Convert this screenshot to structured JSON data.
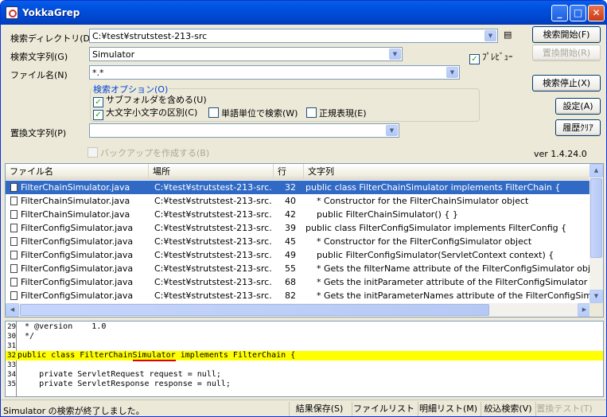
{
  "window": {
    "title": "YokkaGrep"
  },
  "form": {
    "search_dir_label": "検索ディレクトリ(D)",
    "search_dir_value": "C:¥test¥strutstest-213-src",
    "search_str_label": "検索文字列(G)",
    "search_str_value": "Simulator",
    "file_name_label": "ファイル名(N)",
    "file_name_value": "*.*",
    "replace_label": "置換文字列(P)",
    "replace_value": "",
    "preview_label": "ﾌﾟﾚﾋﾞｭｰ",
    "options_title": "検索オプション(O)",
    "opt_subfolder": "サブフォルダを含める(U)",
    "opt_case": "大文字小文字の区別(C)",
    "opt_word": "単語単位で検索(W)",
    "opt_regex": "正規表現(E)",
    "backup": "バックアップを作成する(B)",
    "version": "ver 1.4.24.0"
  },
  "buttons": {
    "start": "検索開始(F)",
    "replace_start": "置換開始(R)",
    "stop": "検索停止(X)",
    "settings": "設定(A)",
    "clear_history": "履歴ｸﾘｱ"
  },
  "list": {
    "headers": [
      "ファイル名",
      "場所",
      "行",
      "文字列"
    ],
    "rows": [
      {
        "file": "FilterChainSimulator.java",
        "path": "C:¥test¥strutstest-213-src...",
        "line": "32",
        "text": "public class FilterChainSimulator implements FilterChain {"
      },
      {
        "file": "FilterChainSimulator.java",
        "path": "C:¥test¥strutstest-213-src...",
        "line": "40",
        "text": "    * Constructor for the FilterChainSimulator object"
      },
      {
        "file": "FilterChainSimulator.java",
        "path": "C:¥test¥strutstest-213-src...",
        "line": "42",
        "text": "    public FilterChainSimulator() { }"
      },
      {
        "file": "FilterConfigSimulator.java",
        "path": "C:¥test¥strutstest-213-src...",
        "line": "39",
        "text": "public class FilterConfigSimulator implements FilterConfig {"
      },
      {
        "file": "FilterConfigSimulator.java",
        "path": "C:¥test¥strutstest-213-src...",
        "line": "45",
        "text": "    * Constructor for the FilterConfigSimulator object"
      },
      {
        "file": "FilterConfigSimulator.java",
        "path": "C:¥test¥strutstest-213-src...",
        "line": "49",
        "text": "    public FilterConfigSimulator(ServletContext context) {"
      },
      {
        "file": "FilterConfigSimulator.java",
        "path": "C:¥test¥strutstest-213-src...",
        "line": "55",
        "text": "    * Gets the filterName attribute of the FilterConfigSimulator objec"
      },
      {
        "file": "FilterConfigSimulator.java",
        "path": "C:¥test¥strutstest-213-src...",
        "line": "68",
        "text": "    * Gets the initParameter attribute of the FilterConfigSimulator ob"
      },
      {
        "file": "FilterConfigSimulator.java",
        "path": "C:¥test¥strutstest-213-src...",
        "line": "82",
        "text": "    * Gets the initParameterNames attribute of the FilterConfigSimul"
      }
    ]
  },
  "editor": {
    "lines": [
      {
        "n": "29",
        "t": " * @version    1.0"
      },
      {
        "n": "30",
        "t": " */"
      },
      {
        "n": "31",
        "t": ""
      },
      {
        "n": "32",
        "pre": "public class FilterChain",
        "match": "Simulator",
        "post": " implements FilterChain {"
      },
      {
        "n": "33",
        "t": ""
      },
      {
        "n": "34",
        "t": "    private ServletRequest request = null;"
      },
      {
        "n": "35",
        "t": "    private ServletResponse response = null;"
      }
    ]
  },
  "status": {
    "message": "Simulator の検索が終了しました。",
    "save": "結果保存(S)",
    "filelist": "ファイルリスト(L)",
    "detail": "明細リスト(M)",
    "narrow": "絞込検索(V)",
    "replace_test": "置換テスト(T)"
  }
}
